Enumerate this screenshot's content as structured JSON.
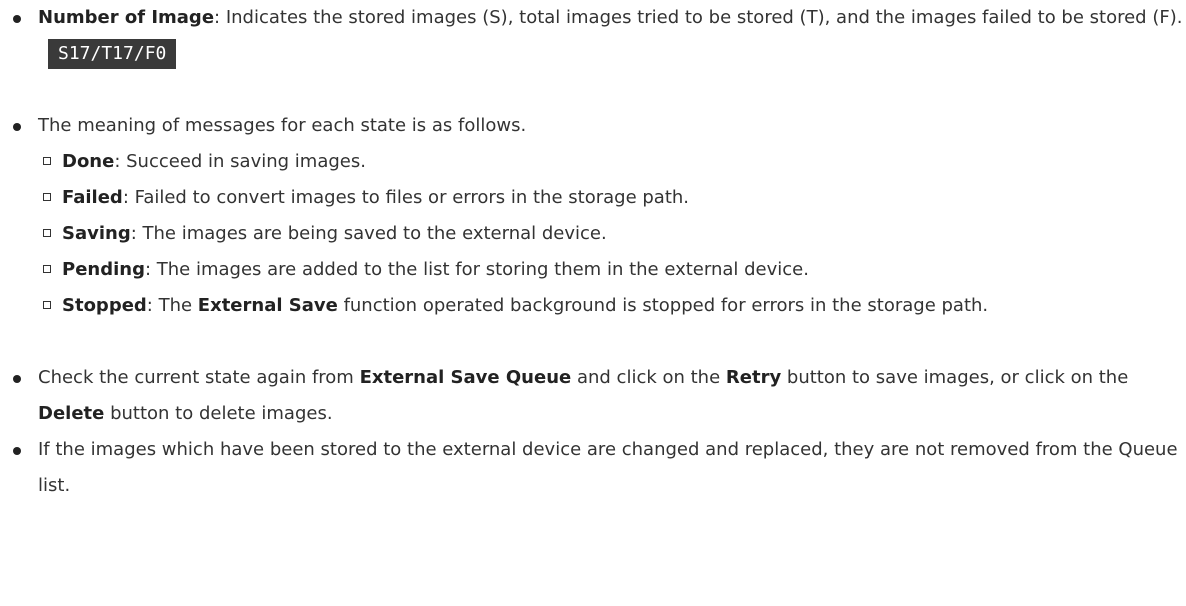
{
  "bullet1": {
    "term": "Number of Image",
    "text": ": Indicates the stored images (S), total images tried to be stored (T), and the images failed to be stored (F).",
    "badge": "S17/T17/F0"
  },
  "bullet2": {
    "text": "The meaning of messages for each state is as follows."
  },
  "states": [
    {
      "term": "Done",
      "desc": ": Succeed in saving images."
    },
    {
      "term": "Failed",
      "desc": ": Failed to convert images to files or errors in the storage path."
    },
    {
      "term": "Saving",
      "desc": ": The images are being saved to the external device."
    },
    {
      "term": "Pending",
      "desc": ": The images are added to the list for storing them in the external device."
    }
  ],
  "stopped": {
    "term": "Stopped",
    "pre": ": The ",
    "func": "External Save",
    "post": " function operated background is stopped for errors in the storage path."
  },
  "bullet3": {
    "t1": "Check the current state again from ",
    "queue": "External Save Queue",
    "t2": " and click on the ",
    "retry": "Retry",
    "t3": " button to save images, or click on the ",
    "delete": "Delete",
    "t4": " button to delete images."
  },
  "bullet4": {
    "text": "If the images which have been stored to the external device are changed and replaced, they are not removed from the Queue list."
  }
}
